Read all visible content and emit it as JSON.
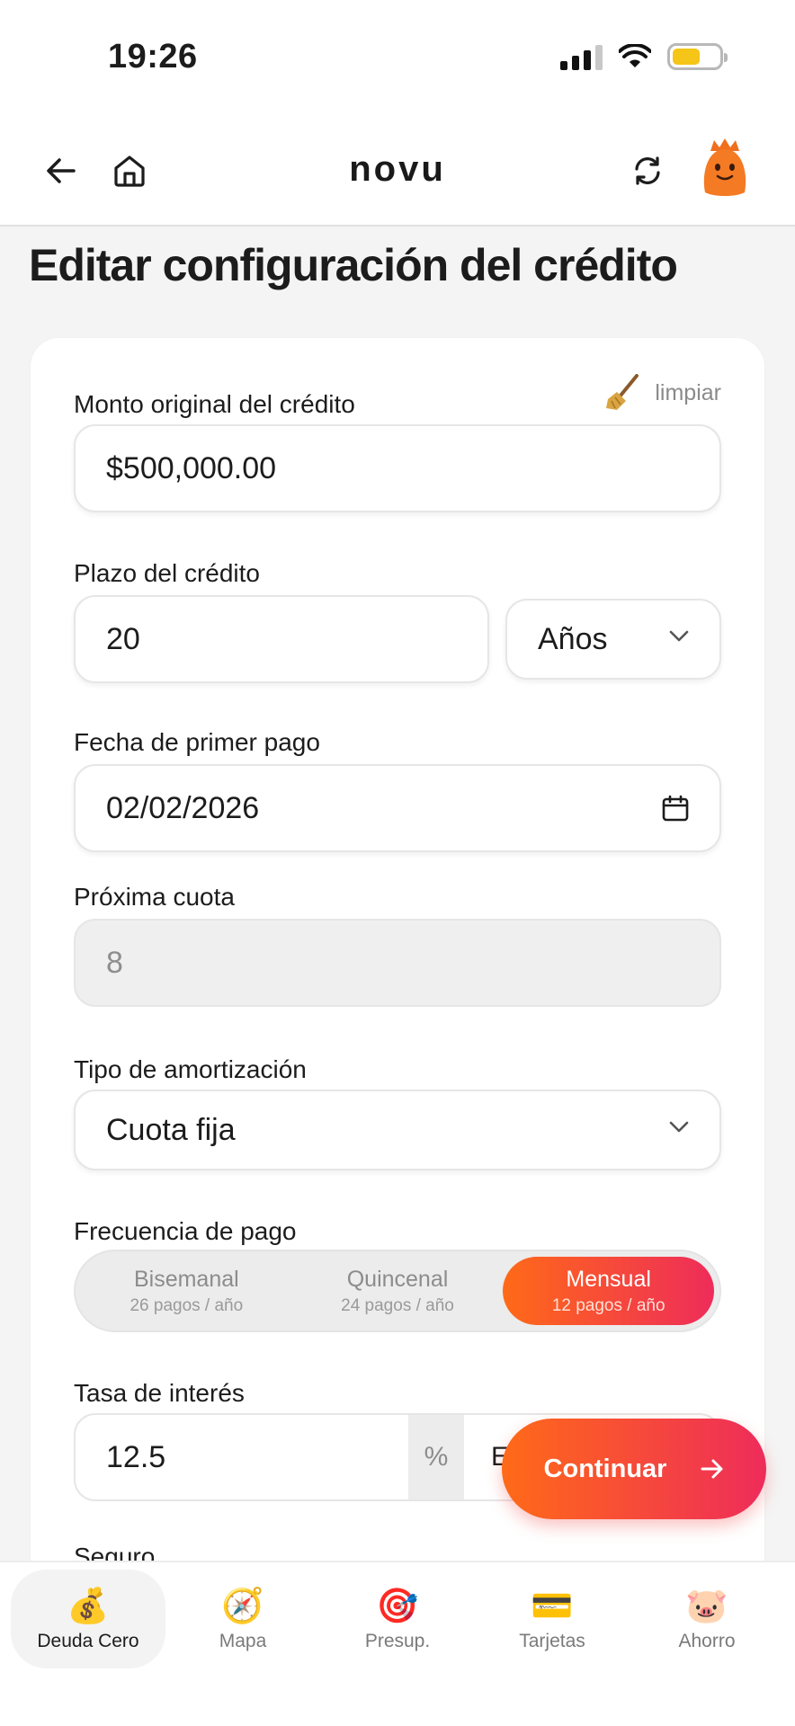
{
  "status": {
    "time": "19:26"
  },
  "header": {
    "logo": "novu"
  },
  "page": {
    "title": "Editar configuración del crédito"
  },
  "form": {
    "clear_label": "limpiar",
    "amount": {
      "label": "Monto original del crédito",
      "value": "$500,000.00"
    },
    "term": {
      "label": "Plazo del crédito",
      "value": "20",
      "unit": "Años"
    },
    "first_payment": {
      "label": "Fecha de primer pago",
      "value": "02/02/2026"
    },
    "next_installment": {
      "label": "Próxima cuota",
      "value": "8"
    },
    "amortization": {
      "label": "Tipo de amortización",
      "value": "Cuota fija"
    },
    "frequency": {
      "label": "Frecuencia de pago",
      "options": [
        {
          "name": "Bisemanal",
          "sub": "26 pagos / año",
          "active": false
        },
        {
          "name": "Quincenal",
          "sub": "24 pagos / año",
          "active": false
        },
        {
          "name": "Mensual",
          "sub": "12 pagos / año",
          "active": true
        }
      ]
    },
    "rate": {
      "label": "Tasa de interés",
      "value": "12.5",
      "unit": "%",
      "type_partial": "E"
    },
    "insurance": {
      "label": "Seguro"
    }
  },
  "continue_button": {
    "label": "Continuar"
  },
  "bottom_nav": {
    "items": [
      {
        "label": "Deuda Cero",
        "icon": "💰",
        "active": true
      },
      {
        "label": "Mapa",
        "icon": "🧭",
        "active": false
      },
      {
        "label": "Presup.",
        "icon": "🎯",
        "active": false
      },
      {
        "label": "Tarjetas",
        "icon": "💳",
        "active": false
      },
      {
        "label": "Ahorro",
        "icon": "🐷",
        "active": false
      }
    ]
  },
  "colors": {
    "accent_start": "#ff6a18",
    "accent_end": "#ee2c5a"
  }
}
